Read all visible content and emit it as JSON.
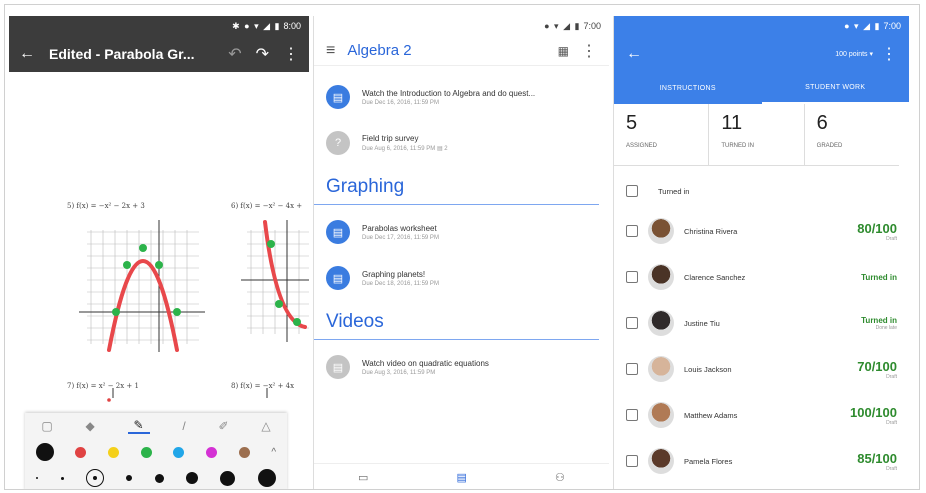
{
  "phone1": {
    "status_time": "8:00",
    "title": "Edited - Parabola Gr...",
    "equations": [
      "5) f(x) = −x² − 2x + 3",
      "6) f(x) = −x² − 4x +",
      "7) f(x) = x² − 2x + 1",
      "8) f(x) = −x² + 4x"
    ],
    "colors": [
      "#111111",
      "#e04343",
      "#f4d01a",
      "#2cb34a",
      "#21a6e8",
      "#d431d4",
      "#9c6f4f"
    ],
    "tool_icons": [
      "eraser-icon",
      "marker-icon",
      "pen-icon",
      "pencil-icon",
      "highlighter-icon",
      "shape-icon"
    ]
  },
  "phone2": {
    "status_time": "7:00",
    "title": "Algebra 2",
    "items_top": [
      {
        "title": "Watch the Introduction to Algebra and do quest...",
        "due": "Due Dec 16, 2016, 11:59 PM",
        "style": "blue"
      },
      {
        "title": "Field trip survey",
        "due": "Due Aug 6, 2016, 11:59 PM  ▤ 2",
        "style": "gray"
      }
    ],
    "section1": "Graphing",
    "items_graphing": [
      {
        "title": "Parabolas worksheet",
        "due": "Due Dec 17, 2016, 11:59 PM",
        "style": "blue"
      },
      {
        "title": "Graphing planets!",
        "due": "Due Dec 18, 2016, 11:59 PM",
        "style": "blue"
      }
    ],
    "section2": "Videos",
    "items_videos": [
      {
        "title": "Watch video on quadratic equations",
        "due": "Due Aug 3, 2016, 11:59 PM",
        "style": "gray"
      }
    ]
  },
  "phone3": {
    "status_time": "7:00",
    "points": "100 points ▾",
    "tab_instructions": "INSTRUCTIONS",
    "tab_student_work": "STUDENT WORK",
    "stats": [
      {
        "n": "5",
        "label": "ASSIGNED"
      },
      {
        "n": "11",
        "label": "TURNED IN"
      },
      {
        "n": "6",
        "label": "GRADED"
      }
    ],
    "turned_in_label": "Turned in",
    "students": [
      {
        "name": "Christina Rivera",
        "grade": "80/100",
        "detail": "Draft",
        "color": "#7a5234"
      },
      {
        "name": "Clarence Sanchez",
        "grade": "Turned in",
        "detail": "",
        "color": "#4a3326"
      },
      {
        "name": "Justine Tiu",
        "grade": "Turned in",
        "detail": "Done late",
        "color": "#2f2a2a"
      },
      {
        "name": "Louis Jackson",
        "grade": "70/100",
        "detail": "Draft",
        "color": "#d6b49a"
      },
      {
        "name": "Matthew Adams",
        "grade": "100/100",
        "detail": "Draft",
        "color": "#b07a55"
      },
      {
        "name": "Pamela Flores",
        "grade": "85/100",
        "detail": "Draft",
        "color": "#5b3a2a"
      }
    ]
  }
}
